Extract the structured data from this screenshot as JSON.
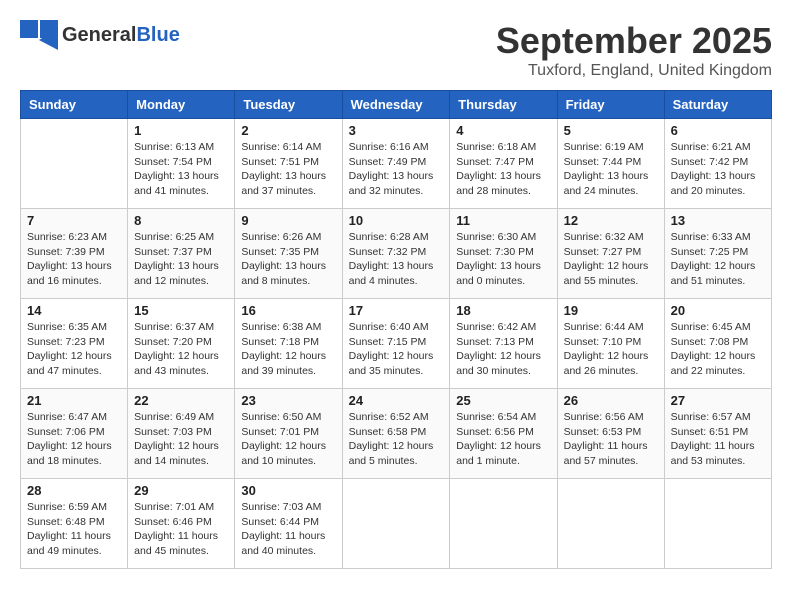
{
  "header": {
    "logo_general": "General",
    "logo_blue": "Blue",
    "month_title": "September 2025",
    "location": "Tuxford, England, United Kingdom"
  },
  "weekdays": [
    "Sunday",
    "Monday",
    "Tuesday",
    "Wednesday",
    "Thursday",
    "Friday",
    "Saturday"
  ],
  "weeks": [
    [
      {
        "day": "",
        "sunrise": "",
        "sunset": "",
        "daylight": ""
      },
      {
        "day": "1",
        "sunrise": "Sunrise: 6:13 AM",
        "sunset": "Sunset: 7:54 PM",
        "daylight": "Daylight: 13 hours and 41 minutes."
      },
      {
        "day": "2",
        "sunrise": "Sunrise: 6:14 AM",
        "sunset": "Sunset: 7:51 PM",
        "daylight": "Daylight: 13 hours and 37 minutes."
      },
      {
        "day": "3",
        "sunrise": "Sunrise: 6:16 AM",
        "sunset": "Sunset: 7:49 PM",
        "daylight": "Daylight: 13 hours and 32 minutes."
      },
      {
        "day": "4",
        "sunrise": "Sunrise: 6:18 AM",
        "sunset": "Sunset: 7:47 PM",
        "daylight": "Daylight: 13 hours and 28 minutes."
      },
      {
        "day": "5",
        "sunrise": "Sunrise: 6:19 AM",
        "sunset": "Sunset: 7:44 PM",
        "daylight": "Daylight: 13 hours and 24 minutes."
      },
      {
        "day": "6",
        "sunrise": "Sunrise: 6:21 AM",
        "sunset": "Sunset: 7:42 PM",
        "daylight": "Daylight: 13 hours and 20 minutes."
      }
    ],
    [
      {
        "day": "7",
        "sunrise": "Sunrise: 6:23 AM",
        "sunset": "Sunset: 7:39 PM",
        "daylight": "Daylight: 13 hours and 16 minutes."
      },
      {
        "day": "8",
        "sunrise": "Sunrise: 6:25 AM",
        "sunset": "Sunset: 7:37 PM",
        "daylight": "Daylight: 13 hours and 12 minutes."
      },
      {
        "day": "9",
        "sunrise": "Sunrise: 6:26 AM",
        "sunset": "Sunset: 7:35 PM",
        "daylight": "Daylight: 13 hours and 8 minutes."
      },
      {
        "day": "10",
        "sunrise": "Sunrise: 6:28 AM",
        "sunset": "Sunset: 7:32 PM",
        "daylight": "Daylight: 13 hours and 4 minutes."
      },
      {
        "day": "11",
        "sunrise": "Sunrise: 6:30 AM",
        "sunset": "Sunset: 7:30 PM",
        "daylight": "Daylight: 13 hours and 0 minutes."
      },
      {
        "day": "12",
        "sunrise": "Sunrise: 6:32 AM",
        "sunset": "Sunset: 7:27 PM",
        "daylight": "Daylight: 12 hours and 55 minutes."
      },
      {
        "day": "13",
        "sunrise": "Sunrise: 6:33 AM",
        "sunset": "Sunset: 7:25 PM",
        "daylight": "Daylight: 12 hours and 51 minutes."
      }
    ],
    [
      {
        "day": "14",
        "sunrise": "Sunrise: 6:35 AM",
        "sunset": "Sunset: 7:23 PM",
        "daylight": "Daylight: 12 hours and 47 minutes."
      },
      {
        "day": "15",
        "sunrise": "Sunrise: 6:37 AM",
        "sunset": "Sunset: 7:20 PM",
        "daylight": "Daylight: 12 hours and 43 minutes."
      },
      {
        "day": "16",
        "sunrise": "Sunrise: 6:38 AM",
        "sunset": "Sunset: 7:18 PM",
        "daylight": "Daylight: 12 hours and 39 minutes."
      },
      {
        "day": "17",
        "sunrise": "Sunrise: 6:40 AM",
        "sunset": "Sunset: 7:15 PM",
        "daylight": "Daylight: 12 hours and 35 minutes."
      },
      {
        "day": "18",
        "sunrise": "Sunrise: 6:42 AM",
        "sunset": "Sunset: 7:13 PM",
        "daylight": "Daylight: 12 hours and 30 minutes."
      },
      {
        "day": "19",
        "sunrise": "Sunrise: 6:44 AM",
        "sunset": "Sunset: 7:10 PM",
        "daylight": "Daylight: 12 hours and 26 minutes."
      },
      {
        "day": "20",
        "sunrise": "Sunrise: 6:45 AM",
        "sunset": "Sunset: 7:08 PM",
        "daylight": "Daylight: 12 hours and 22 minutes."
      }
    ],
    [
      {
        "day": "21",
        "sunrise": "Sunrise: 6:47 AM",
        "sunset": "Sunset: 7:06 PM",
        "daylight": "Daylight: 12 hours and 18 minutes."
      },
      {
        "day": "22",
        "sunrise": "Sunrise: 6:49 AM",
        "sunset": "Sunset: 7:03 PM",
        "daylight": "Daylight: 12 hours and 14 minutes."
      },
      {
        "day": "23",
        "sunrise": "Sunrise: 6:50 AM",
        "sunset": "Sunset: 7:01 PM",
        "daylight": "Daylight: 12 hours and 10 minutes."
      },
      {
        "day": "24",
        "sunrise": "Sunrise: 6:52 AM",
        "sunset": "Sunset: 6:58 PM",
        "daylight": "Daylight: 12 hours and 5 minutes."
      },
      {
        "day": "25",
        "sunrise": "Sunrise: 6:54 AM",
        "sunset": "Sunset: 6:56 PM",
        "daylight": "Daylight: 12 hours and 1 minute."
      },
      {
        "day": "26",
        "sunrise": "Sunrise: 6:56 AM",
        "sunset": "Sunset: 6:53 PM",
        "daylight": "Daylight: 11 hours and 57 minutes."
      },
      {
        "day": "27",
        "sunrise": "Sunrise: 6:57 AM",
        "sunset": "Sunset: 6:51 PM",
        "daylight": "Daylight: 11 hours and 53 minutes."
      }
    ],
    [
      {
        "day": "28",
        "sunrise": "Sunrise: 6:59 AM",
        "sunset": "Sunset: 6:48 PM",
        "daylight": "Daylight: 11 hours and 49 minutes."
      },
      {
        "day": "29",
        "sunrise": "Sunrise: 7:01 AM",
        "sunset": "Sunset: 6:46 PM",
        "daylight": "Daylight: 11 hours and 45 minutes."
      },
      {
        "day": "30",
        "sunrise": "Sunrise: 7:03 AM",
        "sunset": "Sunset: 6:44 PM",
        "daylight": "Daylight: 11 hours and 40 minutes."
      },
      {
        "day": "",
        "sunrise": "",
        "sunset": "",
        "daylight": ""
      },
      {
        "day": "",
        "sunrise": "",
        "sunset": "",
        "daylight": ""
      },
      {
        "day": "",
        "sunrise": "",
        "sunset": "",
        "daylight": ""
      },
      {
        "day": "",
        "sunrise": "",
        "sunset": "",
        "daylight": ""
      }
    ]
  ]
}
